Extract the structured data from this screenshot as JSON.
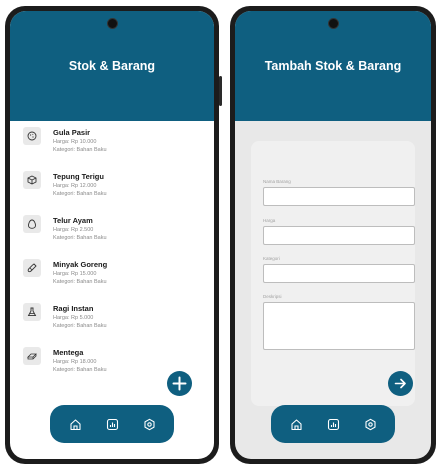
{
  "list_screen": {
    "title": "Stok & Barang",
    "items": [
      {
        "name": "Gula Pasir",
        "price": "Harga: Rp 10.000",
        "category": "Kategori: Bahan Baku",
        "icon": "cookie-icon"
      },
      {
        "name": "Tepung Terigu",
        "price": "Harga: Rp 12.000",
        "category": "Kategori: Bahan Baku",
        "icon": "package-icon"
      },
      {
        "name": "Telur Ayam",
        "price": "Harga: Rp 2.500",
        "category": "Kategori: Bahan Baku",
        "icon": "egg-icon"
      },
      {
        "name": "Minyak Goreng",
        "price": "Harga: Rp 15.000",
        "category": "Kategori: Bahan Baku",
        "icon": "bottle-icon"
      },
      {
        "name": "Ragi Instan",
        "price": "Harga: Rp 5.000",
        "category": "Kategori: Bahan Baku",
        "icon": "flask-icon"
      },
      {
        "name": "Mentega",
        "price": "Harga: Rp 18.000",
        "category": "Kategori: Bahan Baku",
        "icon": "butter-icon"
      }
    ],
    "fab_icon": "plus-icon",
    "nav_icons": [
      "home-icon",
      "chart-icon",
      "settings-icon"
    ]
  },
  "form_screen": {
    "title": "Tambah Stok & Barang",
    "fields": [
      {
        "label": "Nama Barang",
        "value": ""
      },
      {
        "label": "Harga",
        "value": ""
      },
      {
        "label": "Kategori",
        "value": ""
      },
      {
        "label": "Deskripsi",
        "value": ""
      }
    ],
    "submit_icon": "arrow-right-icon",
    "nav_icons": [
      "home-icon",
      "chart-icon",
      "settings-icon"
    ]
  },
  "colors": {
    "primary": "#0f5f80",
    "list_background": "#ffffff",
    "form_background": "#e8e8e8",
    "muted_text": "#8a8a8a"
  }
}
